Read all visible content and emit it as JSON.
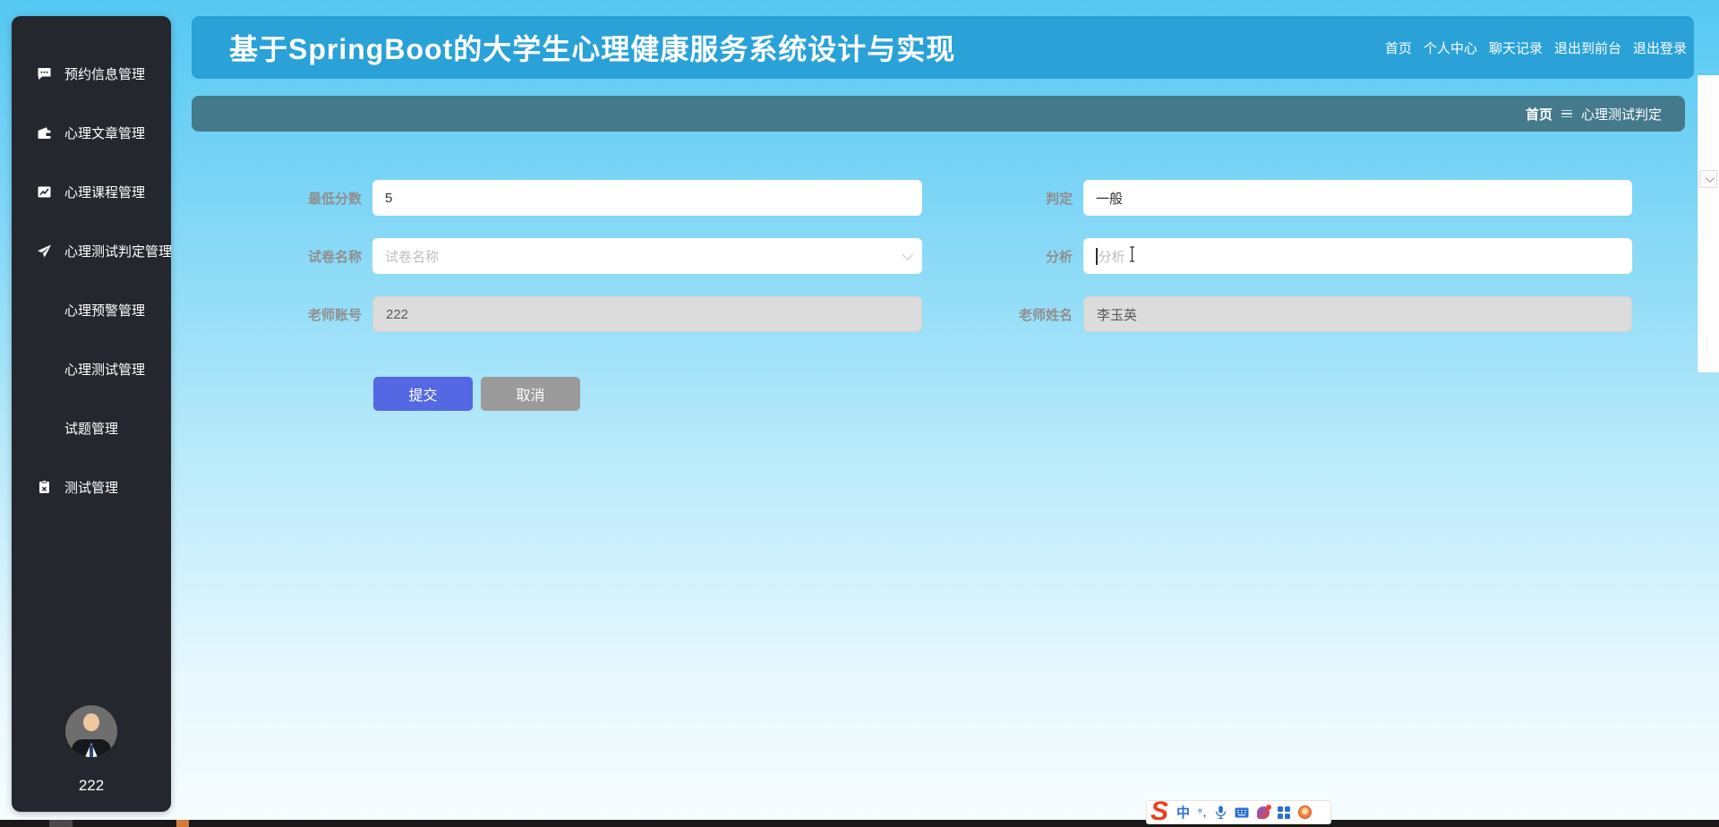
{
  "app": {
    "title": "基于SpringBoot的大学生心理健康服务系统设计与实现"
  },
  "topnav": {
    "links": [
      "首页",
      "个人中心",
      "聊天记录",
      "退出到前台",
      "退出登录"
    ]
  },
  "breadcrumb": {
    "home": "首页",
    "separator_icon": "hamburger-separator-icon",
    "current": "心理测试判定"
  },
  "sidebar": {
    "items": [
      {
        "label": "预约信息管理",
        "icon": "comment-icon"
      },
      {
        "label": "心理文章管理",
        "icon": "wallet-icon"
      },
      {
        "label": "心理课程管理",
        "icon": "chart-line-icon"
      },
      {
        "label": "心理测试判定管理",
        "icon": "paper-plane-icon"
      },
      {
        "label": "心理预警管理",
        "icon": "grid-icon"
      },
      {
        "label": "心理测试管理",
        "icon": "grid-icon"
      },
      {
        "label": "试题管理",
        "icon": "grid-icon"
      },
      {
        "label": "测试管理",
        "icon": "clipboard-x-icon"
      }
    ],
    "user": {
      "name": "222"
    }
  },
  "form": {
    "fields": [
      {
        "label": "最低分数",
        "value": "5",
        "type": "text"
      },
      {
        "label": "判定",
        "value": "一般",
        "type": "text"
      },
      {
        "label": "试卷名称",
        "placeholder": "试卷名称",
        "type": "select"
      },
      {
        "label": "分析",
        "placeholder": "分析",
        "type": "text"
      },
      {
        "label": "老师账号",
        "value": "222",
        "disabled": true
      },
      {
        "label": "老师姓名",
        "value": "李玉英",
        "disabled": true
      }
    ],
    "submit_label": "提交",
    "cancel_label": "取消"
  },
  "ime_toolbar": {
    "logo": "S",
    "mode_label": "中",
    "punct_label": "°,",
    "icons": [
      "sogou-logo-icon",
      "chinese-mode-icon",
      "punctuation-icon",
      "microphone-icon",
      "keyboard-icon",
      "skin-icon",
      "toolbox-icon",
      "emoji-icon"
    ]
  },
  "colors": {
    "header_blue": "#2aa2d8",
    "breadcrumb_teal": "#45798c",
    "sidebar_dark": "#24272d",
    "background_top": "#55c8f2",
    "background_bottom": "#f7fdff",
    "submit_blue": "#5468e3",
    "cancel_gray": "#9b9b9b",
    "sogou_red": "#e8401c"
  }
}
